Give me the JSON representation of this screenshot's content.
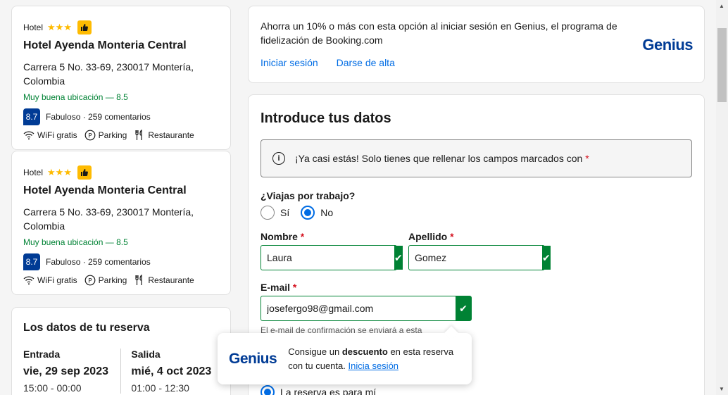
{
  "hotels": [
    {
      "type": "Hotel",
      "stars": "★★★",
      "name": "Hotel Ayenda Monteria Central",
      "address": "Carrera 5 No. 33-69, 230017 Montería, Colombia",
      "location": "Muy buena ubicación — 8.5",
      "score": "8.7",
      "reviews": "Fabuloso · 259 comentarios",
      "amenities": [
        "WiFi gratis",
        "Parking",
        "Restaurante"
      ]
    },
    {
      "type": "Hotel",
      "stars": "★★★",
      "name": "Hotel Ayenda Monteria Central",
      "address": "Carrera 5 No. 33-69, 230017 Montería, Colombia",
      "location": "Muy buena ubicación — 8.5",
      "score": "8.7",
      "reviews": "Fabuloso · 259 comentarios",
      "amenities": [
        "WiFi gratis",
        "Parking",
        "Restaurante"
      ]
    }
  ],
  "booking": {
    "title": "Los datos de tu reserva",
    "checkin_label": "Entrada",
    "checkin_date": "vie, 29 sep 2023",
    "checkin_time": "15:00 - 00:00",
    "checkout_label": "Salida",
    "checkout_date": "mié, 4 oct 2023",
    "checkout_time": "01:00 - 12:30"
  },
  "genius_banner": {
    "text": "Ahorra un 10% o más con esta opción al iniciar sesión en Genius, el programa de fidelización de Booking.com",
    "login": "Iniciar sesión",
    "signup": "Darse de alta",
    "logo": "Genius"
  },
  "form": {
    "title": "Introduce tus datos",
    "info": "¡Ya casi estás! Solo tienes que rellenar los campos marcados con",
    "info_req": "*",
    "work_question": "¿Viajas por trabajo?",
    "opt_yes": "Sí",
    "opt_no": "No",
    "first_name_label": "Nombre",
    "first_name_value": "Laura",
    "last_name_label": "Apellido",
    "last_name_value": "Gomez",
    "email_label": "E-mail",
    "email_value": "josefergo98@gmail.com",
    "email_hint": "El e-mail de confirmación se enviará a esta",
    "req": "*",
    "for_me": "La reserva es para mí"
  },
  "tooltip": {
    "logo": "Genius",
    "text_pre": "Consigue un",
    "text_bold": "descuento",
    "text_post": "en esta reserva con tu cuenta.",
    "link": "Inicia sesión"
  },
  "colors": {
    "brand_blue": "#003b95",
    "link_blue": "#006ce4",
    "success_green": "#008234",
    "star_yellow": "#febb02",
    "required_red": "#d4111e"
  }
}
